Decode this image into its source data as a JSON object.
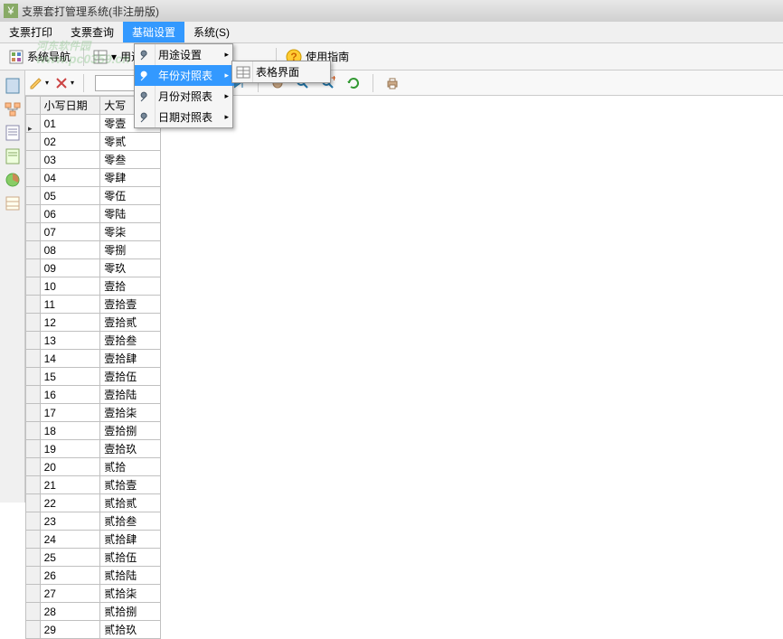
{
  "title": "支票套打管理系统(非注册版)",
  "watermark": {
    "line1": "河东软件园",
    "line2": "www.pc0359.cn"
  },
  "menubar": [
    {
      "label": "支票打印"
    },
    {
      "label": "支票查询"
    },
    {
      "label": "基础设置",
      "active": true
    },
    {
      "label": "系统(S)"
    }
  ],
  "toolbar1": {
    "nav": "系统导航",
    "btn2": "用途设置",
    "help": "使用指南"
  },
  "dropdown1": [
    {
      "label": "用途设置",
      "arrow": true
    },
    {
      "label": "年份对照表",
      "arrow": true,
      "highlight": true
    },
    {
      "label": "月份对照表",
      "arrow": true
    },
    {
      "label": "日期对照表",
      "arrow": true
    }
  ],
  "dropdown2": [
    {
      "label": "表格界面"
    }
  ],
  "grid": {
    "headers": [
      "小写日期",
      "大写"
    ],
    "rows": [
      [
        "01",
        "零壹"
      ],
      [
        "02",
        "零贰"
      ],
      [
        "03",
        "零叁"
      ],
      [
        "04",
        "零肆"
      ],
      [
        "05",
        "零伍"
      ],
      [
        "06",
        "零陆"
      ],
      [
        "07",
        "零柒"
      ],
      [
        "08",
        "零捌"
      ],
      [
        "09",
        "零玖"
      ],
      [
        "10",
        "壹拾"
      ],
      [
        "11",
        "壹拾壹"
      ],
      [
        "12",
        "壹拾贰"
      ],
      [
        "13",
        "壹拾叁"
      ],
      [
        "14",
        "壹拾肆"
      ],
      [
        "15",
        "壹拾伍"
      ],
      [
        "16",
        "壹拾陆"
      ],
      [
        "17",
        "壹拾柒"
      ],
      [
        "18",
        "壹拾捌"
      ],
      [
        "19",
        "壹拾玖"
      ],
      [
        "20",
        "贰拾"
      ],
      [
        "21",
        "贰拾壹"
      ],
      [
        "22",
        "贰拾贰"
      ],
      [
        "23",
        "贰拾叁"
      ],
      [
        "24",
        "贰拾肆"
      ],
      [
        "25",
        "贰拾伍"
      ],
      [
        "26",
        "贰拾陆"
      ],
      [
        "27",
        "贰拾柒"
      ],
      [
        "28",
        "贰拾捌"
      ],
      [
        "29",
        "贰拾玖"
      ]
    ]
  },
  "sidebar_icons": [
    "doc-icon",
    "tree-icon",
    "page-icon",
    "note-icon",
    "chart-icon",
    "sheet-icon"
  ]
}
